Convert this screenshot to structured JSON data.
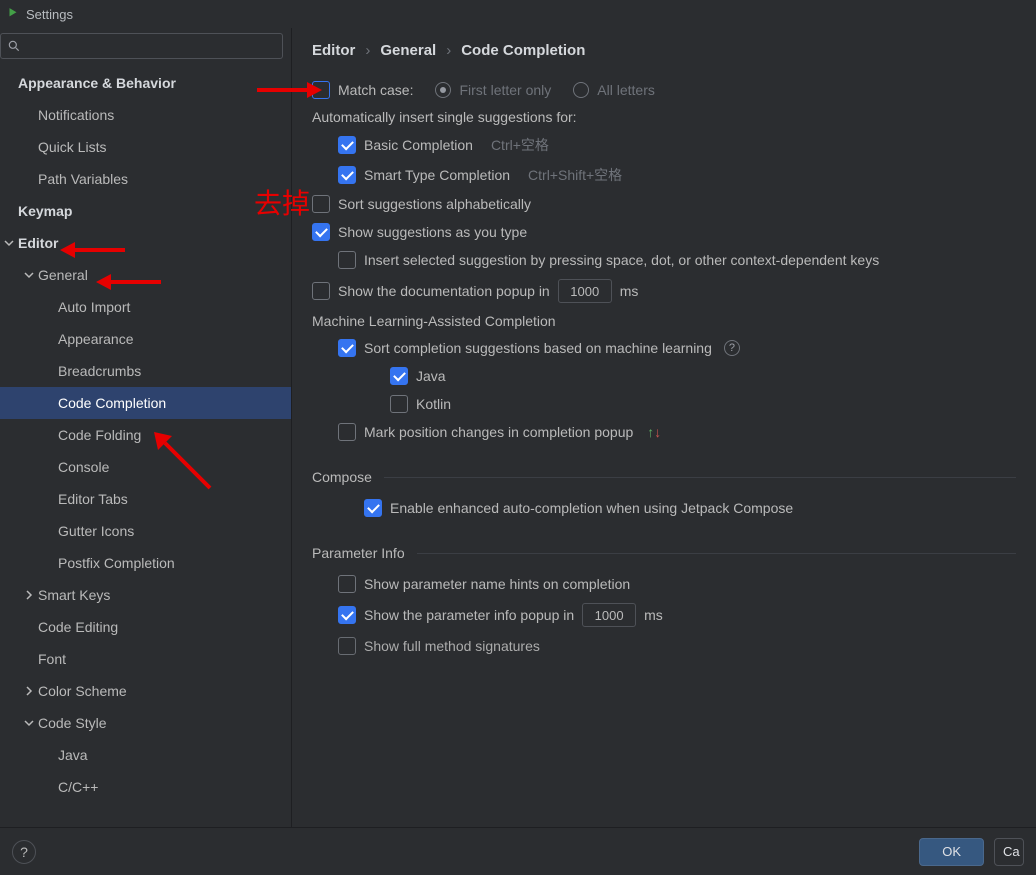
{
  "window": {
    "title": "Settings"
  },
  "search": {
    "placeholder": ""
  },
  "sidebar": {
    "items": [
      {
        "label": "Appearance & Behavior",
        "level": 0,
        "bold": true
      },
      {
        "label": "Notifications",
        "level": 1
      },
      {
        "label": "Quick Lists",
        "level": 1
      },
      {
        "label": "Path Variables",
        "level": 1
      },
      {
        "label": "Keymap",
        "level": 0,
        "bold": true
      },
      {
        "label": "Editor",
        "level": 0,
        "bold": true,
        "expanded": true
      },
      {
        "label": "General",
        "level": 1,
        "expanded": true
      },
      {
        "label": "Auto Import",
        "level": 2
      },
      {
        "label": "Appearance",
        "level": 2
      },
      {
        "label": "Breadcrumbs",
        "level": 2
      },
      {
        "label": "Code Completion",
        "level": 2,
        "selected": true
      },
      {
        "label": "Code Folding",
        "level": 2
      },
      {
        "label": "Console",
        "level": 2
      },
      {
        "label": "Editor Tabs",
        "level": 2
      },
      {
        "label": "Gutter Icons",
        "level": 2
      },
      {
        "label": "Postfix Completion",
        "level": 2
      },
      {
        "label": "Smart Keys",
        "level": 1,
        "collapsed": true
      },
      {
        "label": "Code Editing",
        "level": 1
      },
      {
        "label": "Font",
        "level": 1
      },
      {
        "label": "Color Scheme",
        "level": 1,
        "collapsed": true
      },
      {
        "label": "Code Style",
        "level": 1,
        "expanded": true
      },
      {
        "label": "Java",
        "level": 2
      },
      {
        "label": "C/C++",
        "level": 2
      }
    ]
  },
  "breadcrumb": {
    "a": "Editor",
    "b": "General",
    "c": "Code Completion"
  },
  "settings": {
    "match_case_label": "Match case:",
    "first_letter_label": "First letter only",
    "all_letters_label": "All letters",
    "auto_insert_label": "Automatically insert single suggestions for:",
    "basic_completion_label": "Basic Completion",
    "basic_completion_shortcut": "Ctrl+空格",
    "smart_type_label": "Smart Type Completion",
    "smart_type_shortcut": "Ctrl+Shift+空格",
    "sort_alpha_label": "Sort suggestions alphabetically",
    "show_as_type_label": "Show suggestions as you type",
    "insert_selected_label": "Insert selected suggestion by pressing space, dot, or other context-dependent keys",
    "show_doc_label_pre": "Show the documentation popup in",
    "show_doc_value": "1000",
    "show_doc_unit": "ms",
    "ml_section": "Machine Learning-Assisted Completion",
    "ml_sort_label": "Sort completion suggestions based on machine learning",
    "ml_java_label": "Java",
    "ml_kotlin_label": "Kotlin",
    "mark_position_label": "Mark position changes in completion popup",
    "compose_section": "Compose",
    "compose_enable_label": "Enable enhanced auto-completion when using Jetpack Compose",
    "param_section": "Parameter Info",
    "param_hints_label": "Show parameter name hints on completion",
    "param_popup_pre": "Show the parameter info popup in",
    "param_popup_value": "1000",
    "param_popup_unit": "ms",
    "full_sig_label": "Show full method signatures"
  },
  "footer": {
    "ok": "OK",
    "cancel_partial": "Ca"
  },
  "annotations": {
    "text": "去掉"
  }
}
